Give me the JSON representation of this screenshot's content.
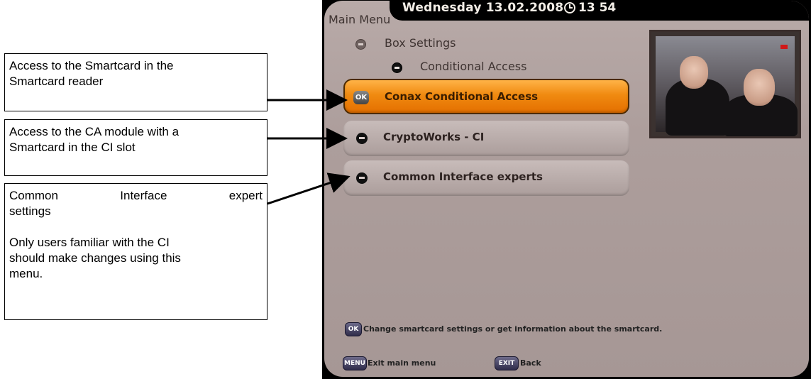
{
  "callouts": {
    "smartcard_reader": [
      "Access to the Smartcard in the",
      "Smartcard reader"
    ],
    "ca_module": [
      "Access to the CA module with a",
      "Smartcard in the CI slot"
    ],
    "ci_experts": {
      "first": [
        "Common",
        "Interface",
        "expert"
      ],
      "first_rest": "settings",
      "note_lines": [
        "Only users familiar with the CI",
        "should make changes using this",
        "menu."
      ]
    }
  },
  "screen": {
    "title": "Main Menu",
    "date": "Wednesday 13.02.2008",
    "time": "13 54",
    "breadcrumb": [
      "Box Settings",
      "Conditional Access"
    ],
    "items": [
      {
        "label": "Conax Conditional Access",
        "selected": true,
        "icon": "ok-icon"
      },
      {
        "label": "CryptoWorks - CI",
        "selected": false,
        "icon": "bullet-icon"
      },
      {
        "label": "Common Interface experts",
        "selected": false,
        "icon": "bullet-icon"
      }
    ],
    "hint": "Change smartcard settings or get information about the smartcard.",
    "footer": {
      "menu_badge": "MENU",
      "menu_label": "Exit main menu",
      "exit_badge": "EXIT",
      "exit_label": "Back",
      "ok_badge": "OK"
    }
  },
  "colors": {
    "selected_item": "#f08a10",
    "panel": "#b0a2a0",
    "topbar": "#000000"
  }
}
